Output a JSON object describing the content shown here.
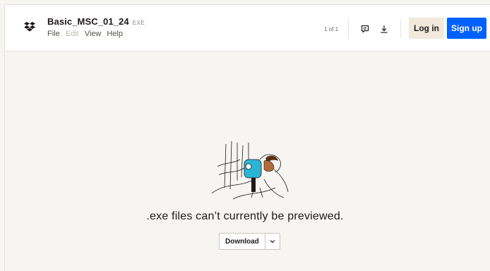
{
  "file": {
    "name": "Basic_MSC_01_24",
    "ext": "EXE"
  },
  "menu": {
    "items": [
      "File",
      "Edit",
      "View",
      "Help"
    ]
  },
  "pager": {
    "text": "1 of 1"
  },
  "auth": {
    "login": "Log in",
    "signup": "Sign up"
  },
  "preview": {
    "message": ".exe files can’t currently be previewed.",
    "download": "Download"
  },
  "colors": {
    "brand": "#0061fe",
    "login_bg": "#f2e8dc",
    "page_bg": "#f7f5f2"
  },
  "icons": {
    "logo": "dropbox-logo-icon",
    "comment": "comment-icon",
    "download": "download-icon",
    "caret": "chevron-down-icon"
  }
}
